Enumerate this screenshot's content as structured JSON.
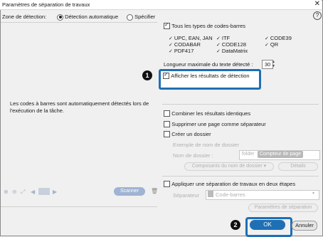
{
  "window": {
    "title": "Paramètres de séparation de travaux",
    "close_glyph": "✕"
  },
  "detection_zone": {
    "label": "Zone de détection:",
    "options": [
      {
        "label": "Détection automatique",
        "selected": true
      },
      {
        "label": "Spécifier",
        "selected": false
      }
    ]
  },
  "left_panel": {
    "message": "Les codes à barres sont automatiquement détectés lors de l'exécution de la tâche.",
    "scan_label": "Scanner",
    "tool_icons": [
      "zoom-in-icon",
      "zoom-out-icon",
      "fit-icon",
      "page-thumbnail-icon",
      "rotate-icon"
    ]
  },
  "help_glyph": "?",
  "barcode_types": {
    "all_label": "Tous les types de codes-barres",
    "items": [
      "UPC, EAN, JAN",
      "ITF",
      "CODE39",
      "CODABAR",
      "CODE128",
      "QR",
      "PDF417",
      "DataMatrix"
    ]
  },
  "max_length": {
    "label": "Longueur maximale du texte détecté :",
    "value": "30"
  },
  "show_results": {
    "label": "Afficher les résultats de détection",
    "checked": true
  },
  "callouts": {
    "one": "1",
    "two": "2"
  },
  "options": {
    "combine_label": "Combiner les résultats identiques",
    "remove_page_label": "Supprimer une page comme séparateur",
    "create_folder_label": "Créer un dossier"
  },
  "folder": {
    "example_label": "Exemple de nom de dossier",
    "name_label": "Nom de dossier :",
    "folder_word": "folder",
    "counter_pill": "Compteur de page",
    "components_button": "Composants du nom de dossier ▾",
    "details_button": "Détails"
  },
  "two_step": {
    "label": "Appliquer une séparation de travaux en deux étapes",
    "separator_label": "Séparateur",
    "separator_value": "Code-barres",
    "params_button": "Paramètres de séparation"
  },
  "footer": {
    "ok": "OK",
    "cancel": "Annuler"
  },
  "colors": {
    "accent": "#1f6fb5",
    "scan_disabled": "#9fb3d2"
  }
}
